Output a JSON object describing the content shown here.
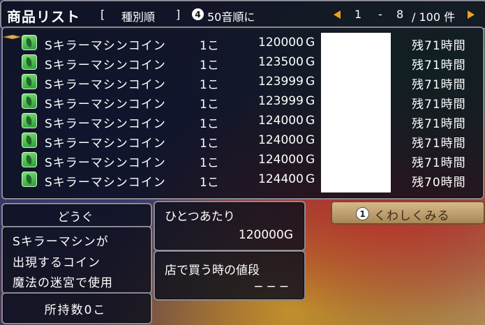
{
  "header": {
    "title": "商品リスト",
    "bracket_open": "[",
    "sort_mode": "種別順",
    "bracket_close": "]",
    "sort_button_number": "4",
    "sort_button_label": "50音順に",
    "page_start": "1",
    "page_sep": "-",
    "page_end": "8",
    "page_total": "/ 100 件"
  },
  "listings": [
    {
      "name": "Sキラーマシンコイン",
      "qty": "1こ",
      "price": "120000",
      "currency": "G",
      "time": "残71時間"
    },
    {
      "name": "Sキラーマシンコイン",
      "qty": "1こ",
      "price": "123500",
      "currency": "G",
      "time": "残71時間"
    },
    {
      "name": "Sキラーマシンコイン",
      "qty": "1こ",
      "price": "123999",
      "currency": "G",
      "time": "残71時間"
    },
    {
      "name": "Sキラーマシンコイン",
      "qty": "1こ",
      "price": "123999",
      "currency": "G",
      "time": "残71時間"
    },
    {
      "name": "Sキラーマシンコイン",
      "qty": "1こ",
      "price": "124000",
      "currency": "G",
      "time": "残71時間"
    },
    {
      "name": "Sキラーマシンコイン",
      "qty": "1こ",
      "price": "124000",
      "currency": "G",
      "time": "残71時間"
    },
    {
      "name": "Sキラーマシンコイン",
      "qty": "1こ",
      "price": "124000",
      "currency": "G",
      "time": "残71時間"
    },
    {
      "name": "Sキラーマシンコイン",
      "qty": "1こ",
      "price": "124400",
      "currency": "G",
      "time": "残70時間"
    }
  ],
  "item_panel": {
    "category": "どうぐ",
    "desc_line1": "Sキラーマシンが",
    "desc_line2": "出現するコイン",
    "desc_line3": "魔法の迷宮で使用",
    "owned": "所持数0こ"
  },
  "price_panel": {
    "unit_label": "ひとつあたり",
    "unit_price": "120000G",
    "buy_label": "店で買う時の値段",
    "buy_price": "−−−"
  },
  "detail_button": {
    "number": "1",
    "label": "くわしくみる"
  },
  "colors": {
    "accent_arrow": "#f0a020",
    "panel_bg": "#0a0e1c",
    "item_icon": "#3cb04a"
  }
}
